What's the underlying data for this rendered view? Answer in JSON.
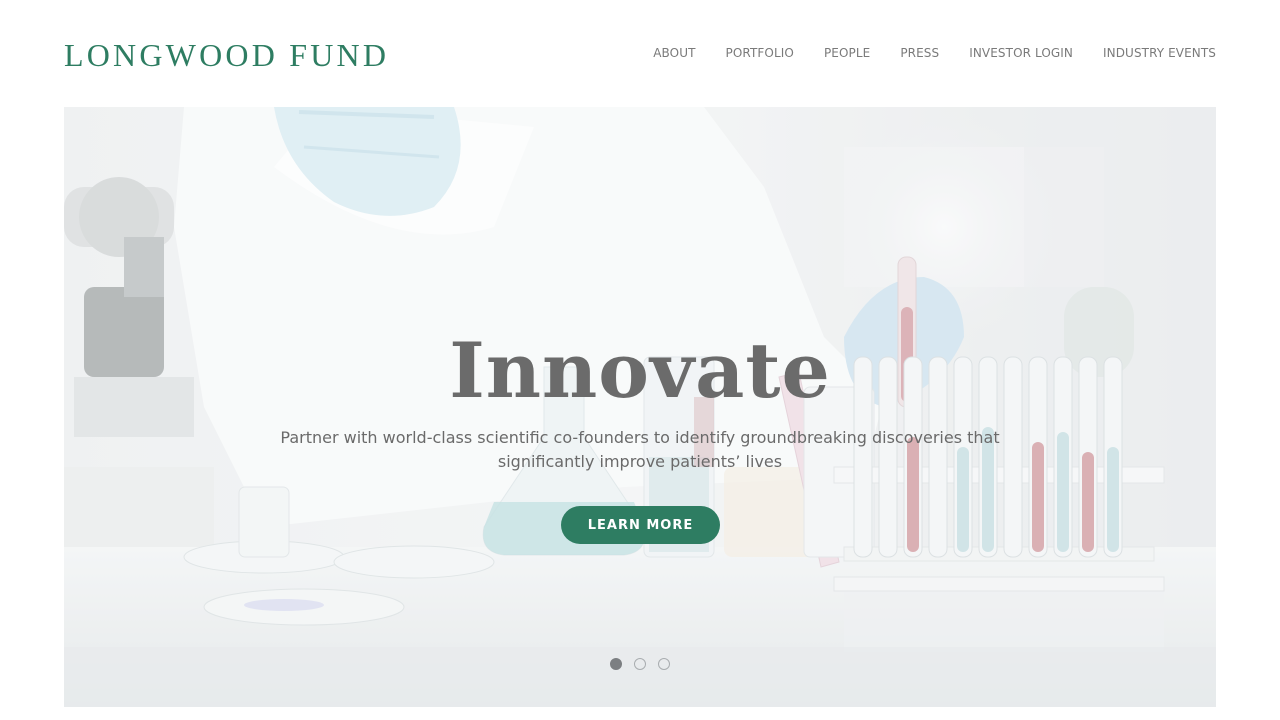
{
  "header": {
    "logo": "LONGWOOD FUND",
    "nav": [
      {
        "label": "ABOUT"
      },
      {
        "label": "PORTFOLIO"
      },
      {
        "label": "PEOPLE"
      },
      {
        "label": "PRESS"
      },
      {
        "label": "INVESTOR LOGIN"
      },
      {
        "label": "INDUSTRY EVENTS"
      }
    ]
  },
  "hero": {
    "title": "Innovate",
    "subtitle": "Partner with world-class scientific co-founders to identify groundbreaking discoveries that significantly improve patients’ lives",
    "button_label": "LEARN MORE",
    "slides": {
      "count": 3,
      "active": 1
    },
    "image_description_icon": "laboratory-scientist-photo"
  },
  "colors": {
    "brand": "#2e7d62",
    "nav_text": "#7a7a7a",
    "hero_title": "#6b6b6b"
  }
}
